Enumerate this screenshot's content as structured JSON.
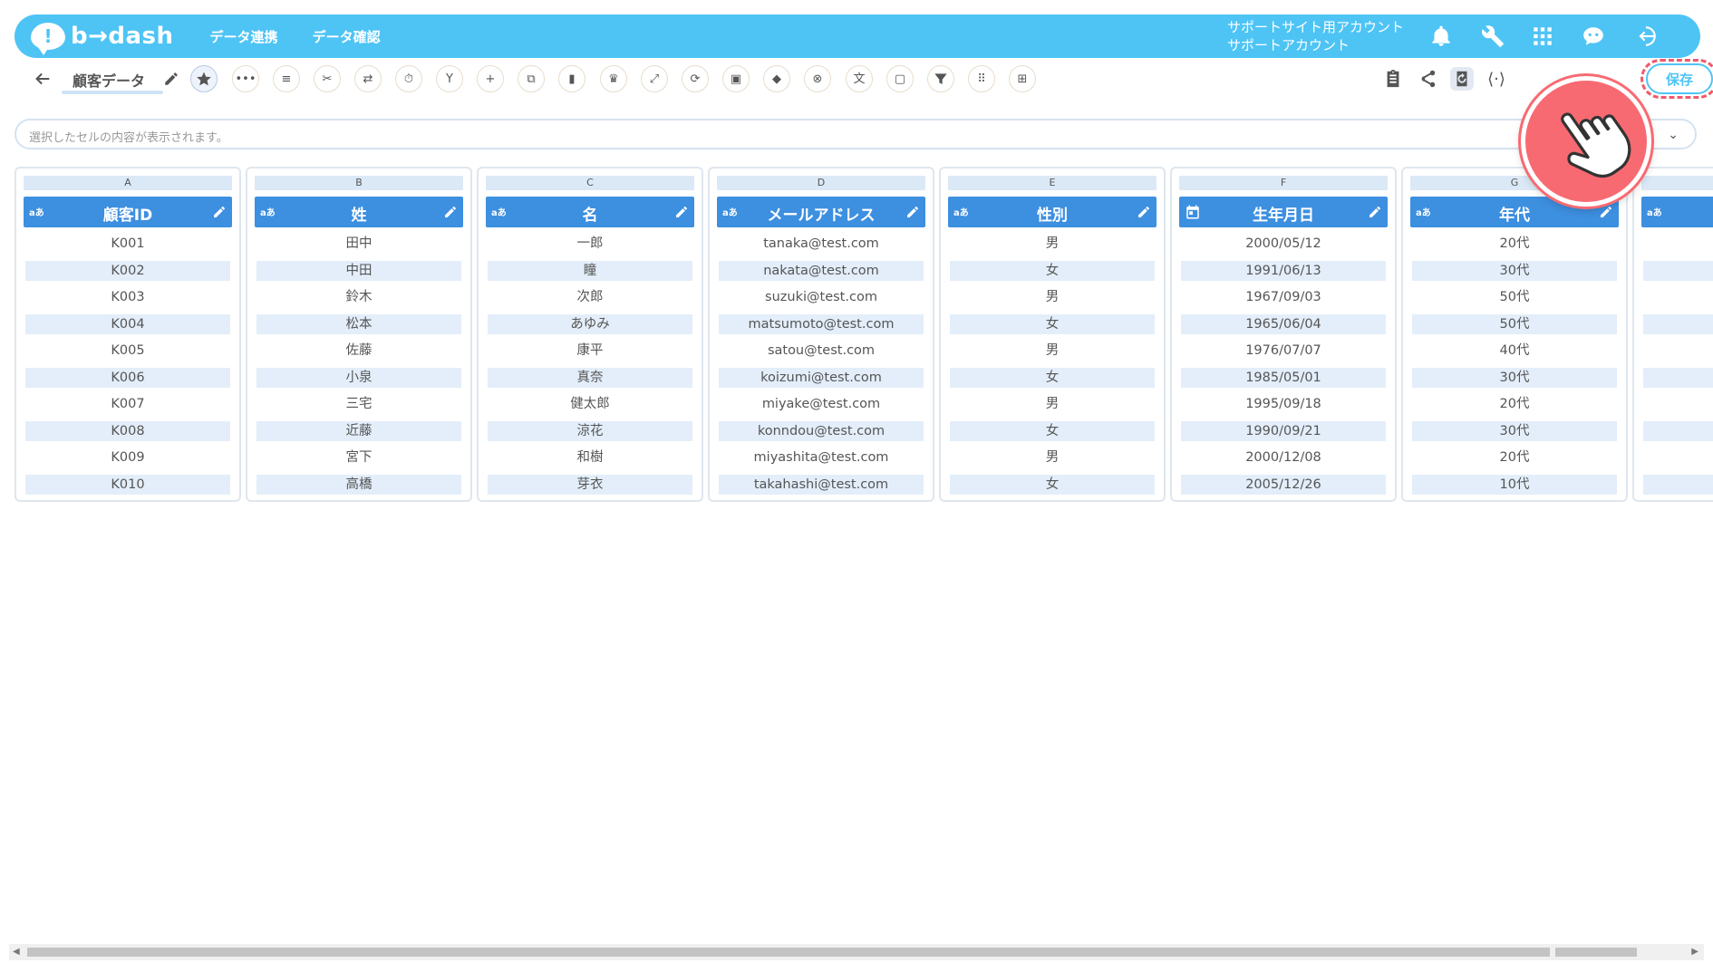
{
  "header": {
    "logo_text": "b→dash",
    "logo_mark": "!",
    "nav": [
      "データ連携",
      "データ確認"
    ],
    "account_line1": "サポートサイト用アカウント",
    "account_line2": "サポートアカウント",
    "icons": [
      "bell-icon",
      "wrench-icon",
      "apps-grid-icon",
      "chat-bot-icon",
      "logout-icon"
    ]
  },
  "toolbar": {
    "back_icon": "arrow-left-icon",
    "sheet_title": "顧客データ",
    "tools": [
      "star-icon",
      "more-icon",
      "list-icon",
      "scissors-icon",
      "swap-icon",
      "timer-icon",
      "merge-icon",
      "plus-icon",
      "copy-icon",
      "trash-icon",
      "crown-icon",
      "expand-icon",
      "repeat-icon",
      "lock-icon",
      "box-icon",
      "cancel-icon",
      "translate-icon",
      "frame-icon",
      "filter-icon",
      "keypad-icon",
      "table-icon"
    ],
    "right_icons": [
      "clipboard-icon",
      "share-icon",
      "refresh-icon",
      "code-icon"
    ],
    "save_label": "保存"
  },
  "cellbar": {
    "placeholder": "選択したセルの内容が表示されます。"
  },
  "columns": [
    {
      "letter": "A",
      "name": "顧客ID",
      "type": "aあ",
      "values": [
        "K001",
        "K002",
        "K003",
        "K004",
        "K005",
        "K006",
        "K007",
        "K008",
        "K009",
        "K010"
      ]
    },
    {
      "letter": "B",
      "name": "姓",
      "type": "aあ",
      "values": [
        "田中",
        "中田",
        "鈴木",
        "松本",
        "佐藤",
        "小泉",
        "三宅",
        "近藤",
        "宮下",
        "高橋"
      ]
    },
    {
      "letter": "C",
      "name": "名",
      "type": "aあ",
      "values": [
        "一郎",
        "瞳",
        "次郎",
        "あゆみ",
        "康平",
        "真奈",
        "健太郎",
        "涼花",
        "和樹",
        "芽衣"
      ]
    },
    {
      "letter": "D",
      "name": "メールアドレス",
      "type": "aあ",
      "values": [
        "tanaka@test.com",
        "nakata@test.com",
        "suzuki@test.com",
        "matsumoto@test.com",
        "satou@test.com",
        "koizumi@test.com",
        "miyake@test.com",
        "konndou@test.com",
        "miyashita@test.com",
        "takahashi@test.com"
      ]
    },
    {
      "letter": "E",
      "name": "性別",
      "type": "aあ",
      "values": [
        "男",
        "女",
        "男",
        "女",
        "男",
        "女",
        "男",
        "女",
        "男",
        "女"
      ]
    },
    {
      "letter": "F",
      "name": "生年月日",
      "type": "calendar",
      "values": [
        "2000/05/12",
        "1991/06/13",
        "1967/09/03",
        "1965/06/04",
        "1976/07/07",
        "1985/05/01",
        "1995/09/18",
        "1990/09/21",
        "2000/12/08",
        "2005/12/26"
      ]
    },
    {
      "letter": "G",
      "name": "年代",
      "type": "aあ",
      "values": [
        "20代",
        "30代",
        "50代",
        "50代",
        "40代",
        "30代",
        "20代",
        "30代",
        "20代",
        "10代"
      ]
    },
    {
      "letter": "",
      "name": "",
      "type": "aあ",
      "values": [
        "",
        "",
        "",
        "",
        "",
        "",
        "",
        "",
        "",
        ""
      ]
    }
  ],
  "colors": {
    "header_bg": "#4ec4f5",
    "column_header_bg": "#3d8fe0",
    "alt_row_bg": "#e3eefa",
    "highlight": "#f05a6b"
  }
}
